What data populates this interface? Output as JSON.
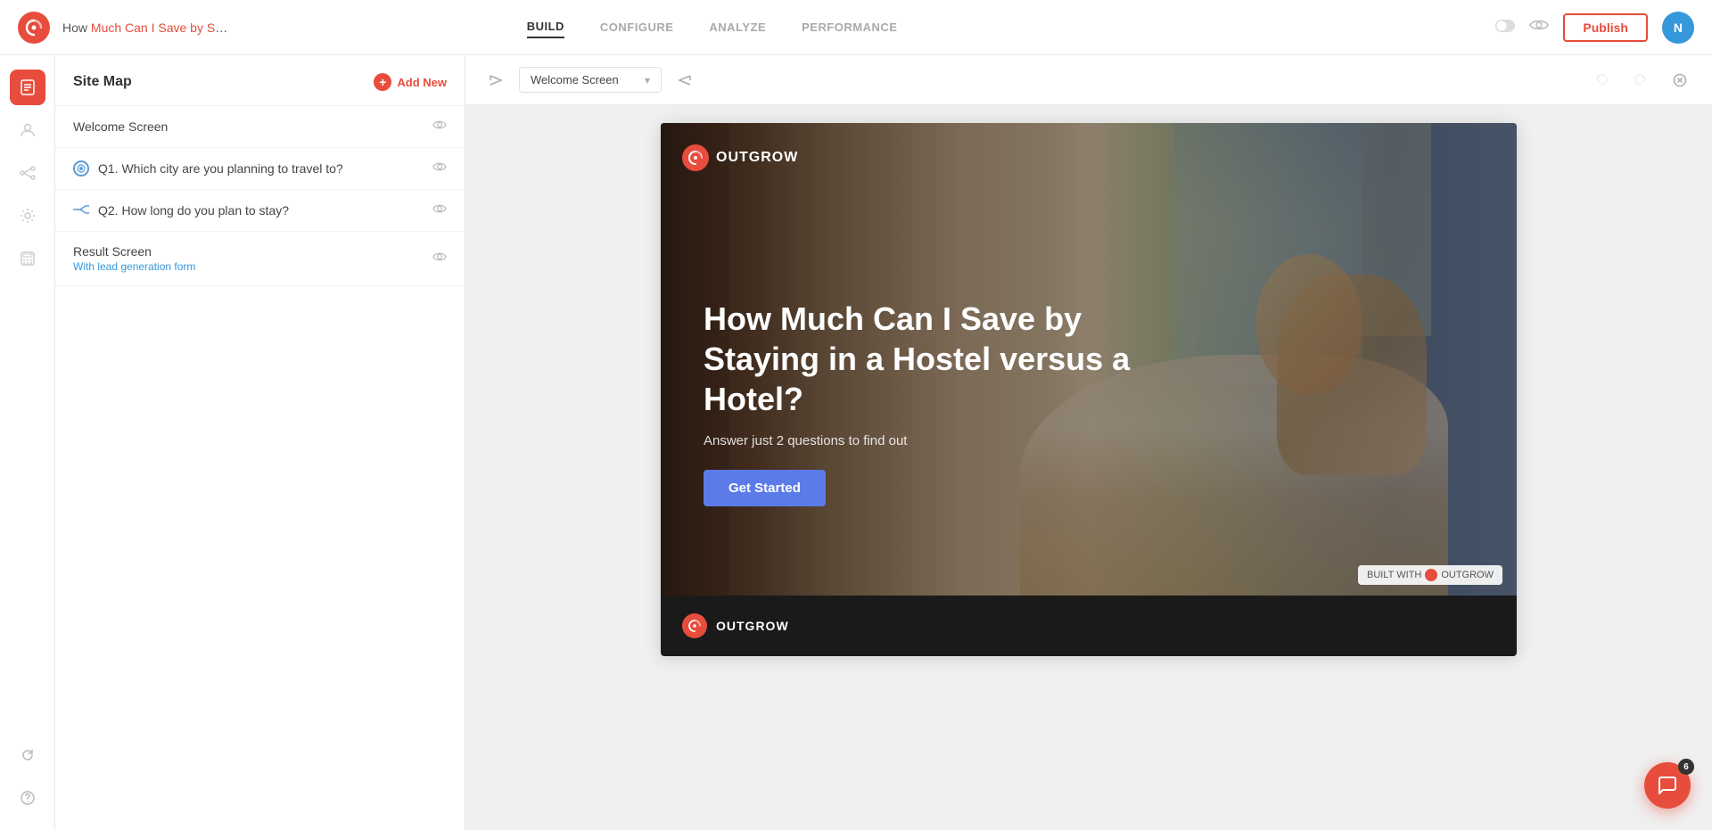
{
  "app": {
    "logo_initial": "⟳",
    "title_prefix": "How ",
    "title_highlight": "Much Can I Save by S",
    "title_suffix": "…"
  },
  "nav": {
    "tabs": [
      {
        "id": "build",
        "label": "BUILD",
        "active": true
      },
      {
        "id": "configure",
        "label": "CONFIGURE",
        "active": false
      },
      {
        "id": "analyze",
        "label": "ANALYZE",
        "active": false
      },
      {
        "id": "performance",
        "label": "PERFORMANCE",
        "active": false
      }
    ],
    "publish_label": "Publish",
    "user_initial": "N"
  },
  "sitemap": {
    "title": "Site Map",
    "add_new_label": "Add New",
    "items": [
      {
        "id": "welcome",
        "label": "Welcome Screen",
        "type": "page"
      },
      {
        "id": "q1",
        "label": "Q1. Which city are you planning to travel to?",
        "type": "question"
      },
      {
        "id": "q2",
        "label": "Q2. How long do you plan to stay?",
        "type": "branch"
      },
      {
        "id": "result",
        "label": "Result Screen",
        "type": "result",
        "sub": "With lead generation form"
      }
    ]
  },
  "toolbar": {
    "prev_label": "⏮",
    "next_label": "⏭",
    "screen_label": "Welcome Screen",
    "undo_label": "↩",
    "redo_label": "↪",
    "close_label": "✕"
  },
  "preview": {
    "logo_text": "OUTGROW",
    "hero_title": "How Much Can I Save by Staying in a Hostel versus a Hotel?",
    "hero_subtitle": "Answer just 2 questions to find out",
    "cta_label": "Get Started",
    "built_with_text": "BUILT WITH",
    "built_with_brand": "OUTGROW",
    "footer_logo": "OUTGROW"
  },
  "chat": {
    "badge": "6",
    "icon": "💬"
  }
}
